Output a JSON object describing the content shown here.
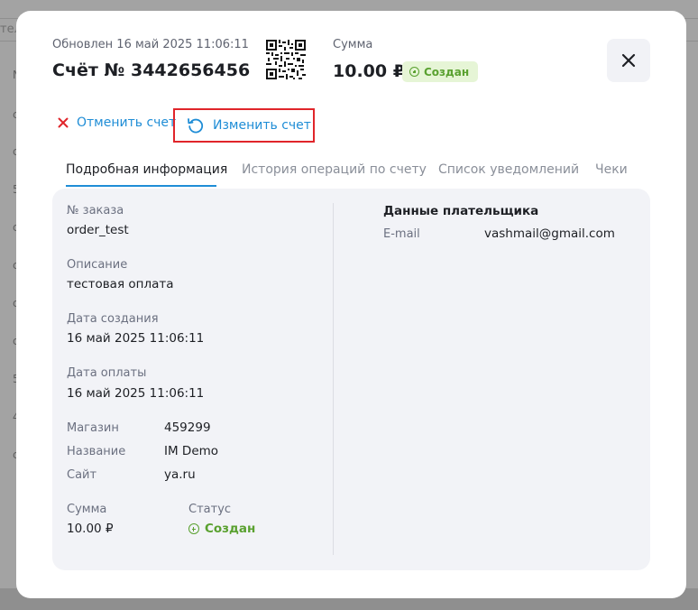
{
  "background": {
    "topbar_text": "тел",
    "column_chars": [
      "N",
      "c",
      "c",
      "5",
      "c",
      "c",
      "c",
      "c",
      "5",
      "4",
      "c"
    ]
  },
  "modal": {
    "updated": "Обновлен 16 май 2025 11:06:11",
    "title": "Счёт № 3442656456",
    "sum_label": "Сумма",
    "sum_value": "10.00 ₽",
    "status_badge": "Создан",
    "actions": {
      "cancel": "Отменить счет",
      "edit": "Изменить счет"
    },
    "tabs": [
      {
        "label": "Подробная информация",
        "active": true
      },
      {
        "label": "История операций по счету",
        "active": false
      },
      {
        "label": "Список уведомлений",
        "active": false
      },
      {
        "label": "Чеки",
        "active": false
      }
    ],
    "details": {
      "order_label": "№ заказа",
      "order_value": "order_test",
      "description_label": "Описание",
      "description_value": "тестовая оплата",
      "created_label": "Дата создания",
      "created_value": "16 май 2025 11:06:11",
      "paid_label": "Дата оплаты",
      "paid_value": "16 май 2025 11:06:11",
      "shop_label": "Магазин",
      "shop_value": "459299",
      "name_label": "Название",
      "name_value": "IM Demo",
      "site_label": "Сайт",
      "site_value": "ya.ru",
      "sum_label": "Сумма",
      "sum_value": "10.00 ₽",
      "status_label": "Статус",
      "status_value": "Создан"
    },
    "payer": {
      "title": "Данные плательщика",
      "email_label": "E-mail",
      "email_value": "vashmail@gmail.com"
    }
  },
  "colors": {
    "accent": "#1f8dd6",
    "success": "#5aa130",
    "danger": "#e0252a"
  }
}
